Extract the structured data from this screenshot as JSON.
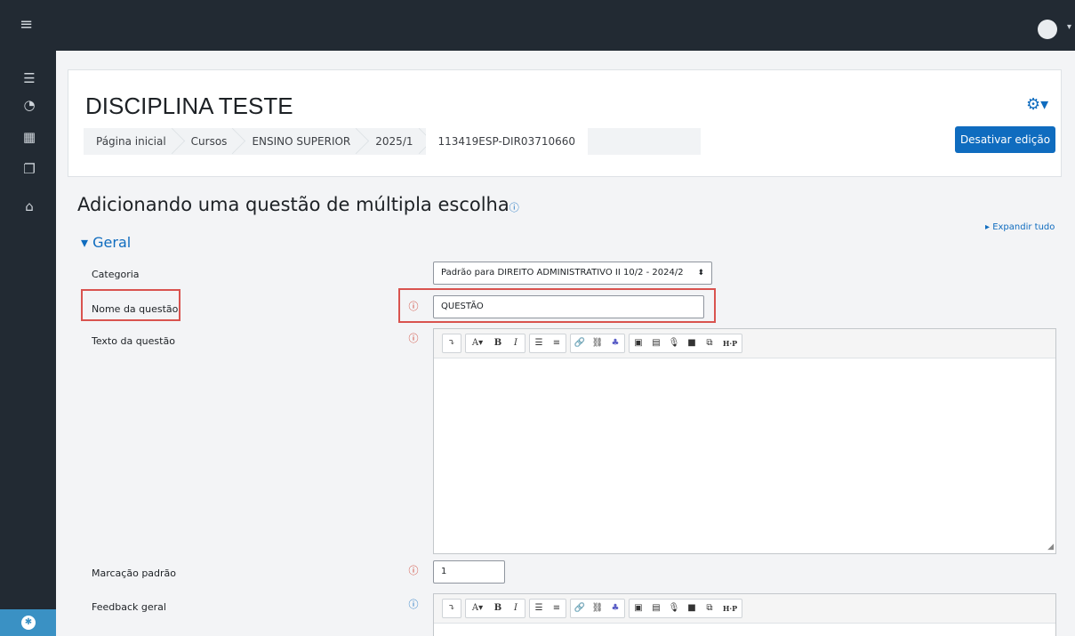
{
  "topbar": {
    "menu_icon": "hamburger-icon",
    "user_icon": "avatar"
  },
  "sidebar": {
    "items": [
      {
        "icon": "list-icon",
        "glyph": "☰"
      },
      {
        "icon": "dashboard-icon",
        "glyph": "◔"
      },
      {
        "icon": "calendar-icon",
        "glyph": "▦"
      },
      {
        "icon": "files-icon",
        "glyph": "❐"
      },
      {
        "icon": "graduation-cap-icon",
        "glyph": "⌂"
      }
    ],
    "bottom_icon": "accessibility-icon"
  },
  "header": {
    "course_title": "DISCIPLINA TESTE",
    "breadcrumb": [
      "Página inicial",
      "Cursos",
      "ENSINO SUPERIOR",
      "2025/1",
      "113419ESP-DIR03710660"
    ],
    "edit_button": "Desativar edição"
  },
  "page": {
    "heading": "Adicionando uma questão de múltipla escolha",
    "expand_all": "▸ Expandir tudo",
    "section_title": "Geral"
  },
  "form": {
    "category_label": "Categoria",
    "category_value": "Padrão para DIREITO ADMINISTRATIVO II 10/2 - 2024/2",
    "name_label": "Nome da questão",
    "name_value": "QUESTÃO",
    "text_label": "Texto da questão",
    "default_mark_label": "Marcação padrão",
    "default_mark_value": "1",
    "feedback_label": "Feedback geral"
  },
  "editor_toolbar": {
    "groups": [
      [
        "⤵"
      ],
      [
        "A▾",
        "B",
        "I"
      ],
      [
        "☰",
        "≡"
      ],
      [
        "🔗",
        "⛓",
        "♣"
      ],
      [
        "▣",
        "▤",
        "🎙",
        "■",
        "⧉",
        "H·P"
      ]
    ]
  },
  "colors": {
    "topbar": "#222a33",
    "primary": "#0f6cbf",
    "required": "#ca3120",
    "highlight": "#d9534f"
  }
}
